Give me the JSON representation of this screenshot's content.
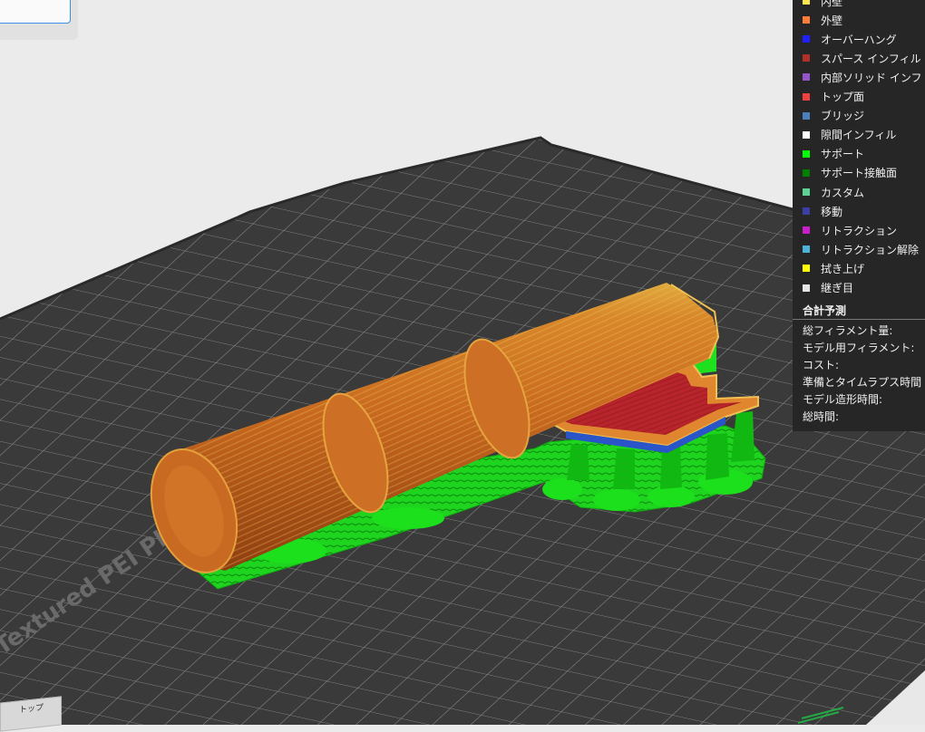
{
  "legend": {
    "items": [
      {
        "label": "内壁",
        "color": "#ffe64d"
      },
      {
        "label": "外壁",
        "color": "#ff7d38"
      },
      {
        "label": "オーバーハング",
        "color": "#1f1fff"
      },
      {
        "label": "スパース インフィル",
        "color": "#b03029"
      },
      {
        "label": "内部ソリッド インフ",
        "color": "#9654cc"
      },
      {
        "label": "トップ面",
        "color": "#f04040"
      },
      {
        "label": "ブリッジ",
        "color": "#4d80ba"
      },
      {
        "label": "隙間インフィル",
        "color": "#ffffff"
      },
      {
        "label": "サポート",
        "color": "#00ff00"
      },
      {
        "label": "サポート接触面",
        "color": "#008000"
      },
      {
        "label": "カスタム",
        "color": "#5ed194"
      },
      {
        "label": "移動",
        "color": "#3d3da6"
      },
      {
        "label": "リトラクション",
        "color": "#cc1fcc"
      },
      {
        "label": "リトラクション解除",
        "color": "#4db3d9"
      },
      {
        "label": "拭き上げ",
        "color": "#ffff00"
      },
      {
        "label": "継ぎ目",
        "color": "#e6e6e6"
      }
    ],
    "summary_title": "合計予測",
    "summary_rows": [
      "総フィラメント量:",
      "モデル用フィラメント:",
      "コスト:",
      "準備とタイムラプス時間",
      "モデル造形時間:",
      "総時間:"
    ]
  },
  "view_cube": {
    "label": "トップ"
  },
  "bed": {
    "label": "Textured PEI Plate"
  }
}
